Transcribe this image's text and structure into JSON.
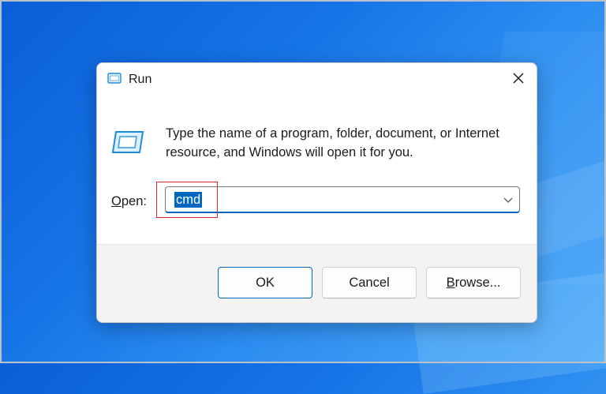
{
  "window": {
    "title": "Run"
  },
  "dialog": {
    "description": "Type the name of a program, folder, document, or Internet resource, and Windows will open it for you.",
    "open_label_accesskey": "O",
    "open_label_rest": "pen:",
    "open_value": "cmd"
  },
  "buttons": {
    "ok": "OK",
    "cancel": "Cancel",
    "browse_accesskey": "B",
    "browse_rest": "rowse..."
  },
  "icons": {
    "title": "run-icon",
    "close": "close-icon",
    "dialog": "run-icon",
    "dropdown": "chevron-down-icon"
  },
  "colors": {
    "accent": "#0067c0",
    "highlight_box": "#e0262a",
    "desktop": "#1673e6"
  }
}
